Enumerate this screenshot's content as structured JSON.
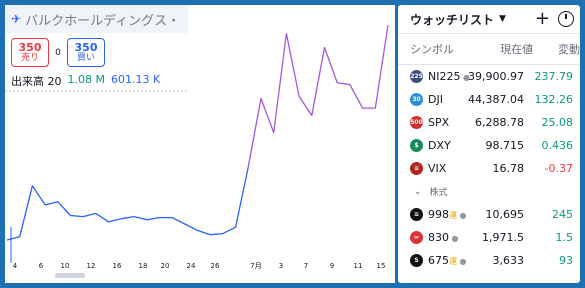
{
  "chart": {
    "symbol_name": "バルクホールディングス・",
    "logo_text": "✈",
    "sell_price": "350",
    "sell_label": "売り",
    "spread": "0",
    "buy_price": "350",
    "buy_label": "買い",
    "volume_label": "出来高 20",
    "volume_value_1": "1.08 M",
    "volume_value_2": "601.13 K",
    "line_color": "#a259d9",
    "prior_line_color": "#2962ff"
  },
  "chart_data": {
    "type": "line",
    "x_tick_labels": [
      "4",
      "6",
      "10",
      "12",
      "16",
      "18",
      "20",
      "24",
      "26",
      "7月",
      "3",
      "7",
      "9",
      "11",
      "15"
    ],
    "series": [
      {
        "values": [
          336,
          339,
          387,
          369,
          372,
          359,
          358,
          361,
          353,
          356,
          358,
          355,
          357,
          357,
          351,
          345,
          341,
          342,
          348,
          405,
          469,
          437,
          530,
          471,
          453,
          517,
          484,
          482,
          460,
          460,
          538
        ]
      }
    ],
    "ylim": [
      320,
      540
    ],
    "grid": false,
    "legend": "none"
  },
  "watchlist": {
    "title": "ウォッチリスト",
    "col_symbol": "シンボル",
    "col_last": "現在値",
    "col_change": "変動",
    "section_label": "株式",
    "rows": [
      {
        "badge": "225",
        "badge_color": "#3d4f7d",
        "symbol": "NI225",
        "flag": "●",
        "last": "39,900.97",
        "change": "237.79",
        "dir": "up"
      },
      {
        "badge": "30",
        "badge_color": "#2a8fd8",
        "symbol": "DJI",
        "flag": "",
        "last": "44,387.04",
        "change": "132.26",
        "dir": "up"
      },
      {
        "badge": "500",
        "badge_color": "#d52a2a",
        "symbol": "SPX",
        "flag": "",
        "last": "6,288.78",
        "change": "25.08",
        "dir": "up"
      },
      {
        "badge": "$",
        "badge_color": "#1b8a5a",
        "symbol": "DXY",
        "flag": "",
        "last": "98.715",
        "change": "0.436",
        "dir": "up"
      },
      {
        "badge": "≡",
        "badge_color": "#b3261e",
        "symbol": "VIX",
        "flag": "",
        "last": "16.78",
        "change": "-0.37",
        "dir": "down"
      }
    ],
    "stocks": [
      {
        "badge": "≡",
        "badge_color": "#111111",
        "symbol": "998",
        "mark": "運",
        "flag": "●",
        "last": "10,695",
        "change": "245",
        "dir": "up"
      },
      {
        "badge": "∞",
        "badge_color": "#d9353a",
        "symbol": "830",
        "mark": "",
        "flag": "●",
        "last": "1,971.5",
        "change": "1.5",
        "dir": "up"
      },
      {
        "badge": "S",
        "badge_color": "#111111",
        "symbol": "675",
        "mark": "運",
        "flag": "●",
        "last": "3,633",
        "change": "93",
        "dir": "up"
      }
    ]
  }
}
